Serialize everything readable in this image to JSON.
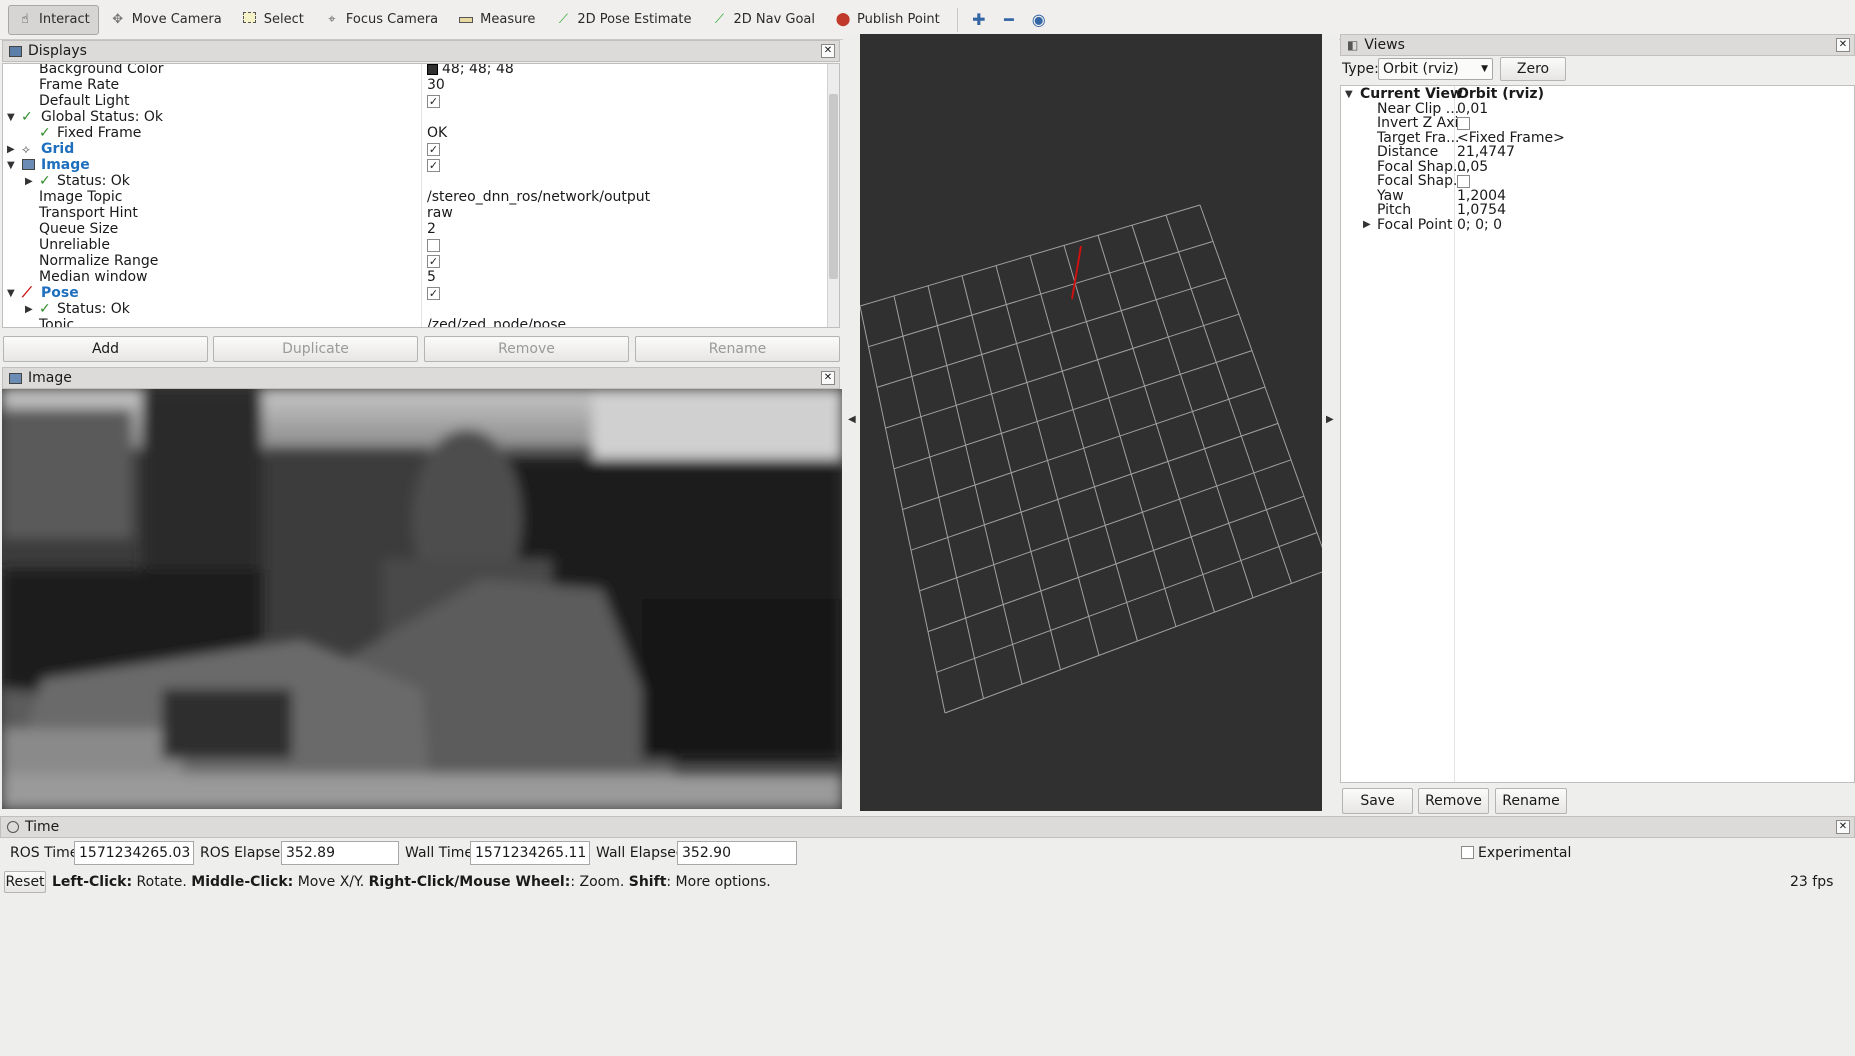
{
  "toolbar": {
    "tools": [
      {
        "label": "Interact",
        "icon": "hand-icon"
      },
      {
        "label": "Move Camera",
        "icon": "move-camera-icon"
      },
      {
        "label": "Select",
        "icon": "select-box-icon"
      },
      {
        "label": "Focus Camera",
        "icon": "focus-icon"
      },
      {
        "label": "Measure",
        "icon": "ruler-icon"
      },
      {
        "label": "2D Pose Estimate",
        "icon": "green-arrow-icon"
      },
      {
        "label": "2D Nav Goal",
        "icon": "green-arrow-icon"
      },
      {
        "label": "Publish Point",
        "icon": "map-pin-icon"
      }
    ]
  },
  "displays": {
    "title": "Displays",
    "rows": [
      {
        "key": "Background Color",
        "value": "48; 48; 48"
      },
      {
        "key": "Frame Rate",
        "value": "30"
      },
      {
        "key": "Default Light",
        "value": ""
      },
      {
        "key": "Global Status: Ok",
        "value": ""
      },
      {
        "key": "Fixed Frame",
        "value": "OK"
      },
      {
        "key": "Grid",
        "value": ""
      },
      {
        "key": "Image",
        "value": ""
      },
      {
        "key": "Status: Ok",
        "value": ""
      },
      {
        "key": "Image Topic",
        "value": "/stereo_dnn_ros/network/output"
      },
      {
        "key": "Transport Hint",
        "value": "raw"
      },
      {
        "key": "Queue Size",
        "value": "2"
      },
      {
        "key": "Unreliable",
        "value": ""
      },
      {
        "key": "Normalize Range",
        "value": ""
      },
      {
        "key": "Median window",
        "value": "5"
      },
      {
        "key": "Pose",
        "value": ""
      },
      {
        "key": "Status: Ok",
        "value": ""
      },
      {
        "key": "Topic",
        "value": "/zed/zed_node/pose"
      }
    ],
    "buttons": {
      "add": "Add",
      "duplicate": "Duplicate",
      "remove": "Remove",
      "rename": "Rename"
    },
    "background_color_hex": "#303030"
  },
  "image_panel": {
    "title": "Image"
  },
  "views": {
    "title": "Views",
    "type_label": "Type:",
    "type_value": "Orbit (rviz)",
    "zero": "Zero",
    "header_key": "Current View",
    "header_value": "Orbit (rviz)",
    "rows": [
      {
        "key": "Near Clip ...",
        "value": "0,01"
      },
      {
        "key": "Invert Z Axis",
        "value": ""
      },
      {
        "key": "Target Fra...",
        "value": "<Fixed Frame>"
      },
      {
        "key": "Distance",
        "value": "21,4747"
      },
      {
        "key": "Focal Shap...",
        "value": "0,05"
      },
      {
        "key": "Focal Shap...",
        "value": ""
      },
      {
        "key": "Yaw",
        "value": "1,2004"
      },
      {
        "key": "Pitch",
        "value": "1,0754"
      },
      {
        "key": "Focal Point",
        "value": "0; 0; 0"
      }
    ],
    "buttons": {
      "save": "Save",
      "remove": "Remove",
      "rename": "Rename"
    }
  },
  "time": {
    "title": "Time",
    "ros_time_label": "ROS Time:",
    "ros_time": "1571234265.03",
    "ros_elapsed_label": "ROS Elapsed:",
    "ros_elapsed": "352.89",
    "wall_time_label": "Wall Time:",
    "wall_time": "1571234265.11",
    "wall_elapsed_label": "Wall Elapsed:",
    "wall_elapsed": "352.90",
    "experimental": "Experimental"
  },
  "status": {
    "reset": "Reset",
    "left_click": "Left-Click:",
    "left_click_desc": " Rotate. ",
    "middle_click": "Middle-Click:",
    "middle_click_desc": " Move X/Y. ",
    "right_click": "Right-Click/Mouse Wheel:",
    "right_click_desc": ": Zoom. ",
    "shift": "Shift",
    "shift_desc": ": More options.",
    "fps": "23 fps"
  },
  "colors": {
    "viewport_bg": "#303030",
    "grid_line": "#a0a0a0",
    "pose_arrow": "#cc1111",
    "accent_blue": "#1f6fbf",
    "ok_green": "#2e8b2e"
  }
}
